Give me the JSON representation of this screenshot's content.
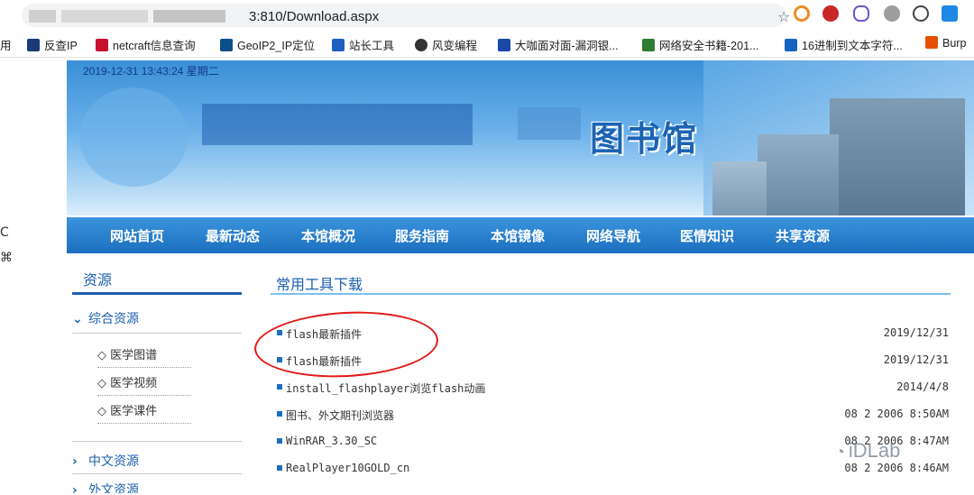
{
  "browser": {
    "url_visible": "3:810/Download.aspx",
    "bookmarks": [
      {
        "label": "用",
        "color": "#888888"
      },
      {
        "label": "反查IP",
        "color": "#1a3a7a"
      },
      {
        "label": "netcraft信息查询",
        "color": "#c8102e"
      },
      {
        "label": "GeoIP2_IP定位",
        "color": "#0b4f8a"
      },
      {
        "label": "站长工具",
        "color": "#1f5fbf"
      },
      {
        "label": "风变编程",
        "color": "#333333"
      },
      {
        "label": "大咖面对面-漏洞银...",
        "color": "#1a47a8"
      },
      {
        "label": "网络安全书籍-201...",
        "color": "#2e7d32"
      },
      {
        "label": "16进制到文本字符...",
        "color": "#1565c0"
      },
      {
        "label": "Burp",
        "color": "#e65100"
      }
    ]
  },
  "page": {
    "datetime": "2019-12-31 13:43:24 星期二",
    "library_title": "图书馆",
    "nav": [
      "网站首页",
      "最新动态",
      "本馆概况",
      "服务指南",
      "本馆镜像",
      "网络导航",
      "医情知识",
      "共享资源"
    ],
    "sidebar": {
      "title": "资源",
      "categories": [
        {
          "label": "综合资源",
          "expanded": true,
          "items": [
            "◇ 医学图谱",
            "◇ 医学视频",
            "◇ 医学课件"
          ]
        },
        {
          "label": "中文资源",
          "expanded": false
        },
        {
          "label": "外文资源",
          "expanded": false
        }
      ]
    },
    "main": {
      "title": "常用工具下载",
      "downloads": [
        {
          "name": "flash最新插件",
          "date": "2019/12/31"
        },
        {
          "name": "flash最新插件",
          "date": "2019/12/31"
        },
        {
          "name": "install_flashplayer浏览flash动画",
          "date": "2014/4/8"
        },
        {
          "name": "图书、外文期刊浏览器",
          "date": "08 2 2006 8:50AM"
        },
        {
          "name": "WinRAR_3.30_SC",
          "date": "08 2 2006 8:47AM"
        },
        {
          "name": "RealPlayer10GOLD_cn",
          "date": "08 2 2006 8:46AM"
        }
      ]
    },
    "watermark": "iDLab",
    "left_edge_fragments": [
      "C",
      "⌘"
    ]
  },
  "colors": {
    "nav_bg": "#1c6fbf",
    "accent": "#1c5fae",
    "annotation_red": "#e01818"
  }
}
